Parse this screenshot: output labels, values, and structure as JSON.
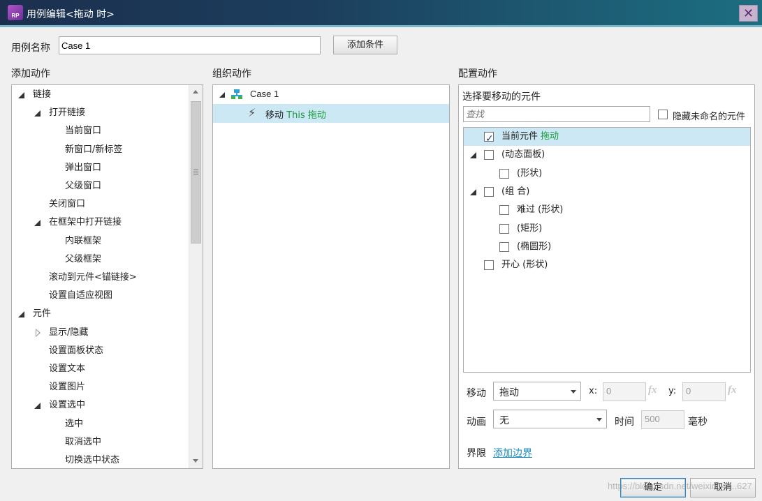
{
  "window": {
    "app_icon_text": "RP",
    "title": "用例编辑<拖动 时>",
    "close_glyph": "✕"
  },
  "case_name": {
    "label": "用例名称",
    "value": "Case 1",
    "add_condition_label": "添加条件"
  },
  "add_actions": {
    "heading": "添加动作",
    "items": [
      {
        "label": "链接",
        "level": 0,
        "arrow": "expanded"
      },
      {
        "label": "打开链接",
        "level": 1,
        "arrow": "expanded"
      },
      {
        "label": "当前窗口",
        "level": 2,
        "arrow": "none"
      },
      {
        "label": "新窗口/新标签",
        "level": 2,
        "arrow": "none"
      },
      {
        "label": "弹出窗口",
        "level": 2,
        "arrow": "none"
      },
      {
        "label": "父级窗口",
        "level": 2,
        "arrow": "none"
      },
      {
        "label": "关闭窗口",
        "level": 1,
        "arrow": "none"
      },
      {
        "label": "在框架中打开链接",
        "level": 1,
        "arrow": "expanded"
      },
      {
        "label": "内联框架",
        "level": 2,
        "arrow": "none"
      },
      {
        "label": "父级框架",
        "level": 2,
        "arrow": "none"
      },
      {
        "label": "滚动到元件<锚链接>",
        "level": 1,
        "arrow": "none"
      },
      {
        "label": "设置自适应视图",
        "level": 1,
        "arrow": "none"
      },
      {
        "label": "元件",
        "level": 0,
        "arrow": "expanded"
      },
      {
        "label": "显示/隐藏",
        "level": 1,
        "arrow": "collapsed"
      },
      {
        "label": "设置面板状态",
        "level": 1,
        "arrow": "none"
      },
      {
        "label": "设置文本",
        "level": 1,
        "arrow": "none"
      },
      {
        "label": "设置图片",
        "level": 1,
        "arrow": "none"
      },
      {
        "label": "设置选中",
        "level": 1,
        "arrow": "expanded"
      },
      {
        "label": "选中",
        "level": 2,
        "arrow": "none"
      },
      {
        "label": "取消选中",
        "level": 2,
        "arrow": "none"
      },
      {
        "label": "切换选中状态",
        "level": 2,
        "arrow": "none"
      }
    ]
  },
  "organize_actions": {
    "heading": "组织动作",
    "case_label": "Case 1",
    "action": {
      "verb": "移动",
      "target": "This 拖动"
    }
  },
  "configure_actions": {
    "heading": "配置动作",
    "select_label": "选择要移动的元件",
    "search_placeholder": "查找",
    "hide_unnamed_label": "隐藏未命名的元件",
    "widgets": [
      {
        "label": "当前元件",
        "suffix": "拖动",
        "level": 0,
        "checked": true,
        "arrow": "none",
        "selected": true
      },
      {
        "label": "(动态面板)",
        "suffix": "",
        "level": 0,
        "checked": false,
        "arrow": "expanded",
        "selected": false
      },
      {
        "label": "(形状)",
        "suffix": "",
        "level": 1,
        "checked": false,
        "arrow": "none",
        "selected": false
      },
      {
        "label": "(组 合)",
        "suffix": "",
        "level": 0,
        "checked": false,
        "arrow": "expanded",
        "selected": false
      },
      {
        "label": "难过 (形状)",
        "suffix": "",
        "level": 1,
        "checked": false,
        "arrow": "none",
        "selected": false
      },
      {
        "label": "(矩形)",
        "suffix": "",
        "level": 1,
        "checked": false,
        "arrow": "none",
        "selected": false
      },
      {
        "label": "(椭圆形)",
        "suffix": "",
        "level": 1,
        "checked": false,
        "arrow": "none",
        "selected": false
      },
      {
        "label": "开心 (形状)",
        "suffix": "",
        "level": 0,
        "checked": false,
        "arrow": "none",
        "selected": false
      }
    ],
    "move": {
      "label": "移动",
      "value": "拖动",
      "x_label": "x:",
      "x_value": "0",
      "y_label": "y:",
      "y_value": "0",
      "fx": "fx"
    },
    "animation": {
      "label": "动画",
      "value": "无",
      "time_label": "时间",
      "time_value": "500",
      "unit": "毫秒"
    },
    "bounds": {
      "label": "界限",
      "link": "添加边界"
    }
  },
  "footer": {
    "ok_label": "确定",
    "cancel_label": "取消",
    "watermark": "https://blog.csdn.net/weixin_44..627"
  },
  "colors": {
    "selection_bg": "#cce8f4",
    "green_text": "#1a9a3a",
    "link": "#1a8ac0"
  }
}
